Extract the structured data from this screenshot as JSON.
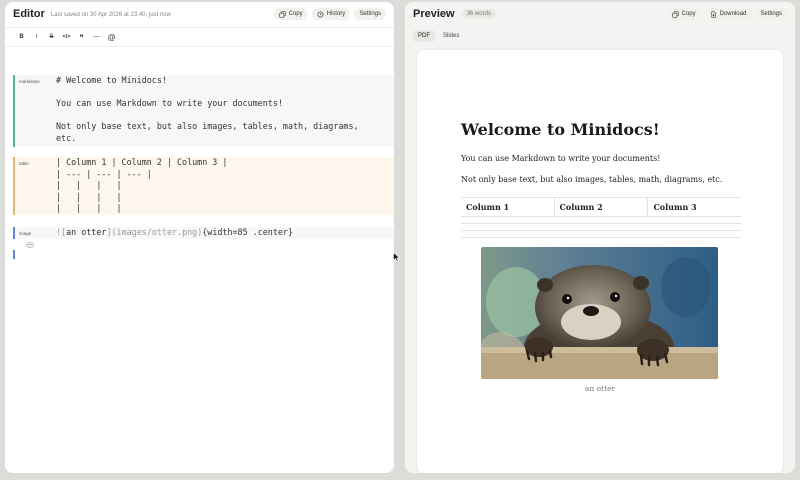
{
  "editor": {
    "title": "Editor",
    "last_saved": "Last saved on 30 Apr 2026 at 23:40, just now",
    "actions": [
      {
        "label": "Copy",
        "icon": "copy-icon"
      },
      {
        "label": "History",
        "icon": "history-icon"
      },
      {
        "label": "Settings",
        "icon": ""
      }
    ],
    "toolbar": [
      {
        "glyph": "B",
        "name": "bold"
      },
      {
        "glyph": "I",
        "name": "italic"
      },
      {
        "glyph": "S",
        "name": "strikethrough"
      },
      {
        "glyph": "</>",
        "name": "code"
      },
      {
        "glyph": "❝",
        "name": "quote"
      },
      {
        "glyph": "—",
        "name": "divider"
      },
      {
        "glyph": "@",
        "name": "mention"
      }
    ],
    "blocks": {
      "markdown": {
        "label": "markdown",
        "lines": [
          "# Welcome to Minidocs!",
          "",
          "You can use Markdown to write your documents!",
          "",
          "Not only base text, but also images, tables, math, diagrams,",
          "etc."
        ]
      },
      "table": {
        "label": "table",
        "lines": [
          "| Column 1 | Column 2 | Column 3 |",
          "| --- | --- | --- |",
          "|   |   |   |",
          "|   |   |   |",
          "|   |   |   |"
        ]
      },
      "image": {
        "label": "image",
        "prefix": "![",
        "alt": "an otter",
        "path": "](images/otter.png)",
        "attrs": "{width=85 .center}",
        "toggle": "—"
      }
    }
  },
  "preview": {
    "title": "Preview",
    "word_count": "36 words",
    "actions": [
      {
        "label": "Copy",
        "icon": "copy-icon"
      },
      {
        "label": "Download",
        "icon": "download-icon"
      },
      {
        "label": "Settings",
        "icon": ""
      }
    ],
    "tabs": [
      {
        "label": "PDF",
        "active": true
      },
      {
        "label": "Slides",
        "active": false
      }
    ],
    "doc": {
      "heading": "Welcome to Minidocs!",
      "paragraphs": [
        "You can use Markdown to write your documents!",
        "Not only base text, but also images, tables, math, diagrams, etc."
      ],
      "table_headers": [
        "Column 1",
        "Column 2",
        "Column 3"
      ],
      "image_caption": "an otter"
    }
  },
  "colors": {
    "markdown_accent": "#58b39b",
    "table_accent": "#e3b76a",
    "image_accent": "#5b87d4",
    "background": "#dcdcd8"
  }
}
